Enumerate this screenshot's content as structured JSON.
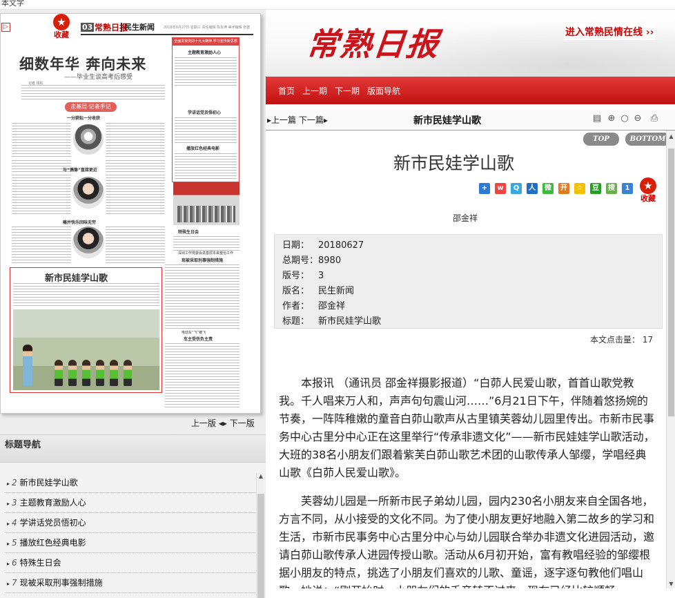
{
  "top_strip": {
    "text": "本文字"
  },
  "left": {
    "favorite_label": "收藏",
    "newspaper_page": {
      "page_no": "03",
      "logo": "常熟日报",
      "section": "民生新闻",
      "date_line": "2018年6月27日 星期三  责任编辑 陈永坤  美术编辑 张建",
      "headline": "细数年华 奔向未来",
      "subhead": "——毕业生谈高考后感受",
      "byline": "记者 钱松",
      "red_tag": "走基层·记者手记",
      "cap1": "一分耕耘一分收获",
      "cap2": "与“偶像”直接更近",
      "cap3": "痛并快乐回味无穷",
      "right_news_head": "全面贯彻党的十九大精神 学习宣传新思想",
      "rn1": "主题教育激励人心",
      "rn2": "学讲话党员悟初心",
      "rn3": "播放红色经典电影",
      "rn4": "特殊生日会",
      "rn5a": "深圳工作党委会进基层本来整治工作",
      "rn5b": "现被采取刑事强制措施",
      "rn6a": "电动车“飞“被飞",
      "rn6b": "车主受伤负主责",
      "article_title": "新市民娃学山歌"
    },
    "page_nav": {
      "prev": "上一版",
      "next": "下一版"
    },
    "nav": {
      "title": "标题导航",
      "items": [
        {
          "num": "2",
          "label": "新市民娃学山歌"
        },
        {
          "num": "3",
          "label": "主题教育激励人心"
        },
        {
          "num": "4",
          "label": "学讲话党员悟初心"
        },
        {
          "num": "5",
          "label": "播放红色经典电影"
        },
        {
          "num": "6",
          "label": "特殊生日会"
        },
        {
          "num": "7",
          "label": "现被采取刑事强制措施"
        }
      ]
    }
  },
  "right": {
    "logo": "常熟日报",
    "civic_link": "进入常熟民情在线 ››",
    "menu": [
      "首页",
      "上一期",
      "下一期",
      "版面导航"
    ],
    "article_bar": {
      "prevnext": "上一篇 下一篇",
      "title": "新市民娃学山歌"
    },
    "top_button": "TOP",
    "bottom_button": "BOTTOM",
    "title": "新市民娃学山歌",
    "favorite_label": "收藏",
    "author": "邵金祥",
    "info": {
      "date_label": "日期：",
      "date": "20180627",
      "issue_label": "总期号：",
      "issue": "8980",
      "page_label": "版号：",
      "page": "3",
      "section_label": "版名：",
      "section": "民生新闻",
      "author_label": "作者：",
      "author": "邵金祥",
      "title_label": "标题：",
      "title": "新市民娃学山歌"
    },
    "hits_label": "本文点击量：",
    "hits": "17",
    "paragraphs": [
      "本报讯 （通讯员 邵金祥摄影报道）“白茆人民爱山歌，首首山歌党教我。千人唱来万人和，声声句句震山河……”6月21日下午，伴随着悠扬婉的节奏，一阵阵稚嫩的童音白茆山歌声从古里镇芙蓉幼儿园里传出。市新市民事务中心古里分中心正在这里举行“传承非遗文化”——新市民娃娃学山歌活动，大班的38名小朋友们跟着紫芙白茆山歌艺术团的山歌传承人邹缨，学唱经典山歌《白茆人民爱山歌》。",
      "芙蓉幼儿园是一所新市民子弟幼儿园，园内230名小朋友来自全国各地，方言不同，从小接受的文化不同。为了使小朋友更好地融入第二故乡的学习和生活，市新市民事务中心古里分中心与幼儿园联合举办非遗文化进园活动，邀请白茆山歌传承人进园传授山歌。活动从6月初开始，富有教唱经验的邹缨根据小朋友的特点，挑选了小朋友们喜欢的儿歌、童谣，逐字逐句教他们唱山歌。她说：“刚开始时，小朋友们的舌音转不过来，现在已经比较顺畅"
    ]
  },
  "colors": {
    "brand_red": "#c8141a",
    "menu_red": "#d42020",
    "link_red": "#d40000"
  }
}
